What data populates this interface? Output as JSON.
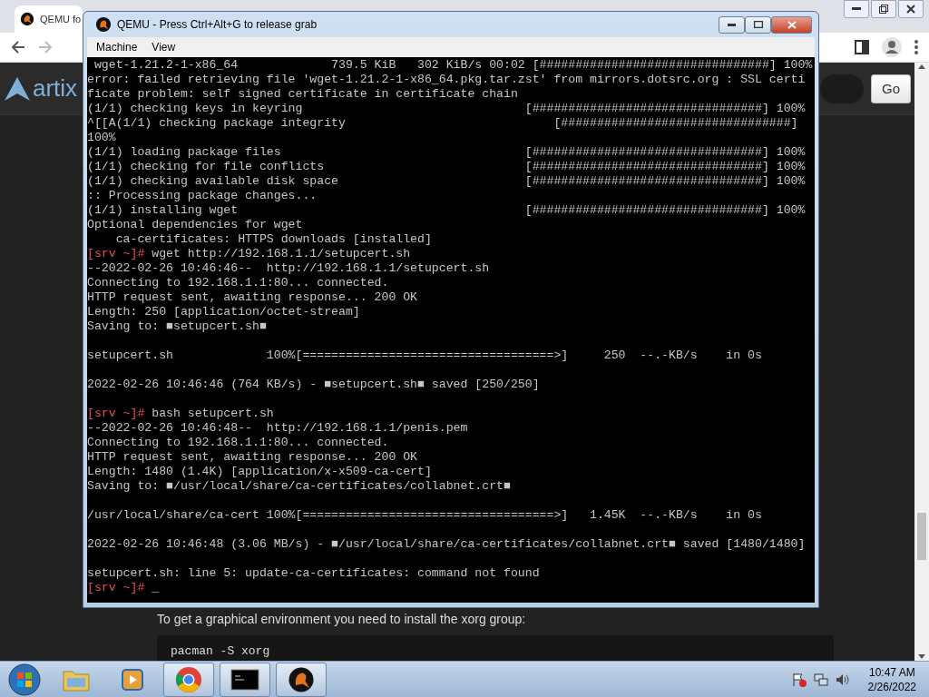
{
  "browser": {
    "tab": {
      "title": "QEMU fo"
    },
    "logo_text": "artix",
    "go_button": "Go",
    "paragraph": "To get a graphical environment you need to install the xorg group:",
    "code": "pacman -S xorg"
  },
  "qemu": {
    "title": "QEMU - Press Ctrl+Alt+G to release grab",
    "menu": [
      "Machine",
      "View"
    ],
    "terminal": {
      "blocks": [
        {
          "lines": [
            {
              "text": " wget-1.21.2-1-x86_64             739.5 KiB   302 KiB/s 00:02 [################################] 100%"
            },
            {
              "text": "error: failed retrieving file 'wget-1.21.2-1-x86_64.pkg.tar.zst' from mirrors.dotsrc.org : SSL certi"
            },
            {
              "text": "ficate problem: self signed certificate in certificate chain"
            },
            {
              "text": "(1/1) checking keys in keyring                               [################################] 100%"
            },
            {
              "text": "^[[A(1/1) checking package integrity                             [################################]"
            },
            {
              "text": "100%"
            },
            {
              "text": "(1/1) loading package files                                  [################################] 100%"
            },
            {
              "text": "(1/1) checking for file conflicts                            [################################] 100%"
            },
            {
              "text": "(1/1) checking available disk space                          [################################] 100%"
            },
            {
              "text": ":: Processing package changes..."
            },
            {
              "text": "(1/1) installing wget                                        [################################] 100%"
            },
            {
              "text": "Optional dependencies for wget"
            },
            {
              "text": "    ca-certificates: HTTPS downloads [installed]"
            },
            {
              "prompt": "[srv ~]#",
              "text": " wget http://192.168.1.1/setupcert.sh"
            },
            {
              "text": "--2022-02-26 10:46:46--  http://192.168.1.1/setupcert.sh"
            },
            {
              "text": "Connecting to 192.168.1.1:80... connected."
            },
            {
              "text": "HTTP request sent, awaiting response... 200 OK"
            },
            {
              "text": "Length: 250 [application/octet-stream]"
            },
            {
              "text": "Saving to: ■setupcert.sh■"
            }
          ]
        },
        {
          "lines": [
            {
              "text": "setupcert.sh             100%[===================================>]     250  --.-KB/s    in 0s"
            }
          ]
        },
        {
          "lines": [
            {
              "text": "2022-02-26 10:46:46 (764 KB/s) - ■setupcert.sh■ saved [250/250]"
            }
          ]
        },
        {
          "lines": [
            {
              "prompt": "[srv ~]#",
              "text": " bash setupcert.sh"
            },
            {
              "text": "--2022-02-26 10:46:48--  http://192.168.1.1/penis.pem"
            },
            {
              "text": "Connecting to 192.168.1.1:80... connected."
            },
            {
              "text": "HTTP request sent, awaiting response... 200 OK"
            },
            {
              "text": "Length: 1480 (1.4K) [application/x-x509-ca-cert]"
            },
            {
              "text": "Saving to: ■/usr/local/share/ca-certificates/collabnet.crt■"
            }
          ]
        },
        {
          "lines": [
            {
              "text": "/usr/local/share/ca-cert 100%[===================================>]   1.45K  --.-KB/s    in 0s"
            }
          ]
        },
        {
          "lines": [
            {
              "text": "2022-02-26 10:46:48 (3.06 MB/s) - ■/usr/local/share/ca-certificates/collabnet.crt■ saved [1480/1480]"
            }
          ]
        },
        {
          "lines": [
            {
              "text": "setupcert.sh: line 5: update-ca-certificates: command not found"
            },
            {
              "prompt": "[srv ~]#",
              "text": " _"
            }
          ]
        }
      ]
    }
  },
  "taskbar": {
    "apps": [
      {
        "kind": "explorer",
        "running": false
      },
      {
        "kind": "media",
        "running": false
      },
      {
        "kind": "chrome",
        "running": true
      },
      {
        "kind": "cmd",
        "running": true
      },
      {
        "kind": "qemu",
        "running": true
      }
    ],
    "clock": {
      "time": "10:47 AM",
      "date": "2/26/2022"
    }
  }
}
